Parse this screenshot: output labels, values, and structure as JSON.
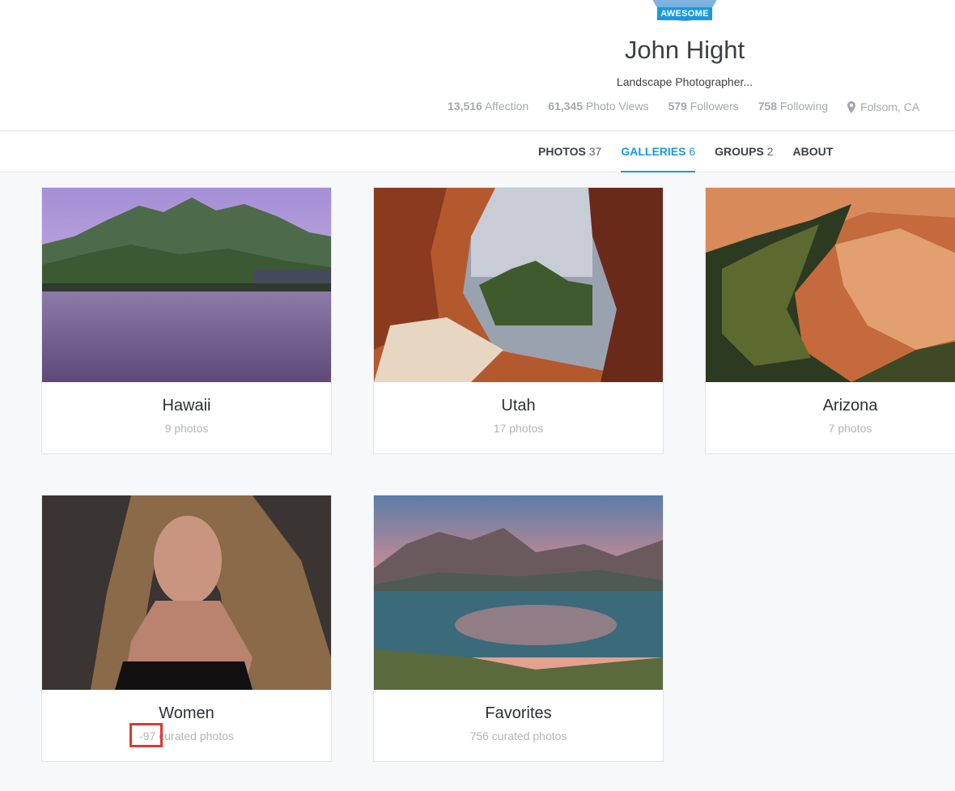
{
  "profile": {
    "badge": "AWESOME",
    "name": "John Hight",
    "bio": "Landscape Photographer...",
    "stats": [
      {
        "value": "13,516",
        "label": "Affection"
      },
      {
        "value": "61,345",
        "label": "Photo Views"
      },
      {
        "value": "579",
        "label": "Followers"
      },
      {
        "value": "758",
        "label": "Following"
      }
    ],
    "location": "Folsom, CA"
  },
  "tabs": [
    {
      "label": "PHOTOS",
      "count": "37",
      "active": false
    },
    {
      "label": "GALLERIES",
      "count": "6",
      "active": true
    },
    {
      "label": "GROUPS",
      "count": "2",
      "active": false
    },
    {
      "label": "ABOUT",
      "count": "",
      "active": false
    }
  ],
  "galleries": [
    {
      "title": "Hawaii",
      "subtitle": "9 photos"
    },
    {
      "title": "Utah",
      "subtitle": "17 photos"
    },
    {
      "title": "Arizona",
      "subtitle": "7 photos"
    },
    {
      "title": "Women",
      "subtitle": "-97 curated photos"
    },
    {
      "title": "Favorites",
      "subtitle": "756 curated photos"
    }
  ],
  "colors": {
    "accent": "#1a99de",
    "highlight": "#e1382f"
  }
}
